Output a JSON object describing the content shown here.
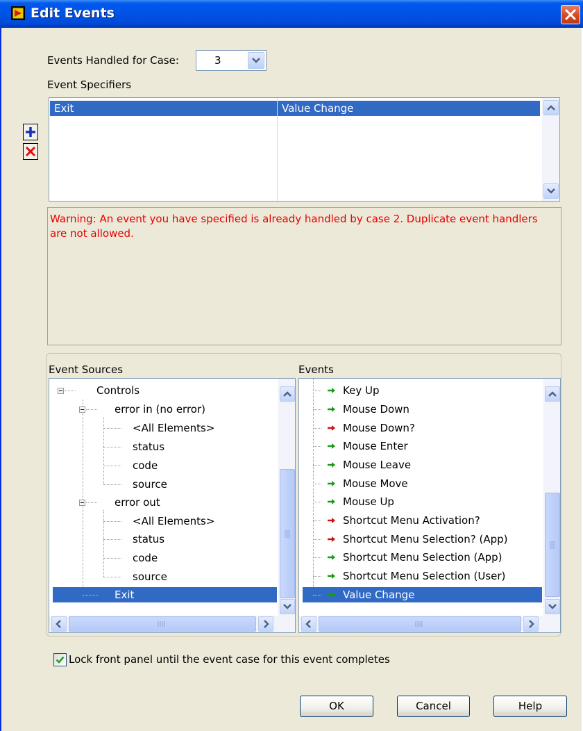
{
  "window": {
    "title": "Edit Events"
  },
  "case_selector": {
    "label": "Events Handled for Case:",
    "value": "3"
  },
  "event_specifiers": {
    "label": "Event Specifiers",
    "rows": [
      {
        "source": "Exit",
        "event": "Value Change"
      }
    ]
  },
  "warning": "Warning:  An event you have specified is already handled by case 2. Duplicate event handlers are not allowed.",
  "event_sources": {
    "label": "Event Sources",
    "items": [
      {
        "text": "Controls",
        "level": 0,
        "expand": "minus"
      },
      {
        "text": "error in (no error)",
        "level": 1,
        "expand": "minus"
      },
      {
        "text": "<All Elements>",
        "level": 2
      },
      {
        "text": "status",
        "level": 2
      },
      {
        "text": "code",
        "level": 2
      },
      {
        "text": "source",
        "level": 2
      },
      {
        "text": "error out",
        "level": 1,
        "expand": "minus"
      },
      {
        "text": "<All Elements>",
        "level": 2
      },
      {
        "text": "status",
        "level": 2
      },
      {
        "text": "code",
        "level": 2
      },
      {
        "text": "source",
        "level": 2
      },
      {
        "text": "Exit",
        "level": 1,
        "selected": true
      }
    ]
  },
  "events": {
    "label": "Events",
    "items": [
      {
        "text": "Key Up",
        "arrow": "green"
      },
      {
        "text": "Mouse Down",
        "arrow": "green"
      },
      {
        "text": "Mouse Down?",
        "arrow": "red"
      },
      {
        "text": "Mouse Enter",
        "arrow": "green"
      },
      {
        "text": "Mouse Leave",
        "arrow": "green"
      },
      {
        "text": "Mouse Move",
        "arrow": "green"
      },
      {
        "text": "Mouse Up",
        "arrow": "green"
      },
      {
        "text": "Shortcut Menu Activation?",
        "arrow": "red"
      },
      {
        "text": "Shortcut Menu Selection? (App)",
        "arrow": "red"
      },
      {
        "text": "Shortcut Menu Selection (App)",
        "arrow": "green"
      },
      {
        "text": "Shortcut Menu Selection (User)",
        "arrow": "green"
      },
      {
        "text": "Value Change",
        "arrow": "green",
        "selected": true
      }
    ]
  },
  "lock_panel": {
    "label": "Lock front panel until the event case for this event completes",
    "checked": true
  },
  "buttons": {
    "ok": "OK",
    "cancel": "Cancel",
    "help": "Help"
  },
  "colors": {
    "arrow_green": "#1a9a1a",
    "arrow_red": "#c81414",
    "selection": "#316ac5",
    "warning_text": "#e60000"
  }
}
